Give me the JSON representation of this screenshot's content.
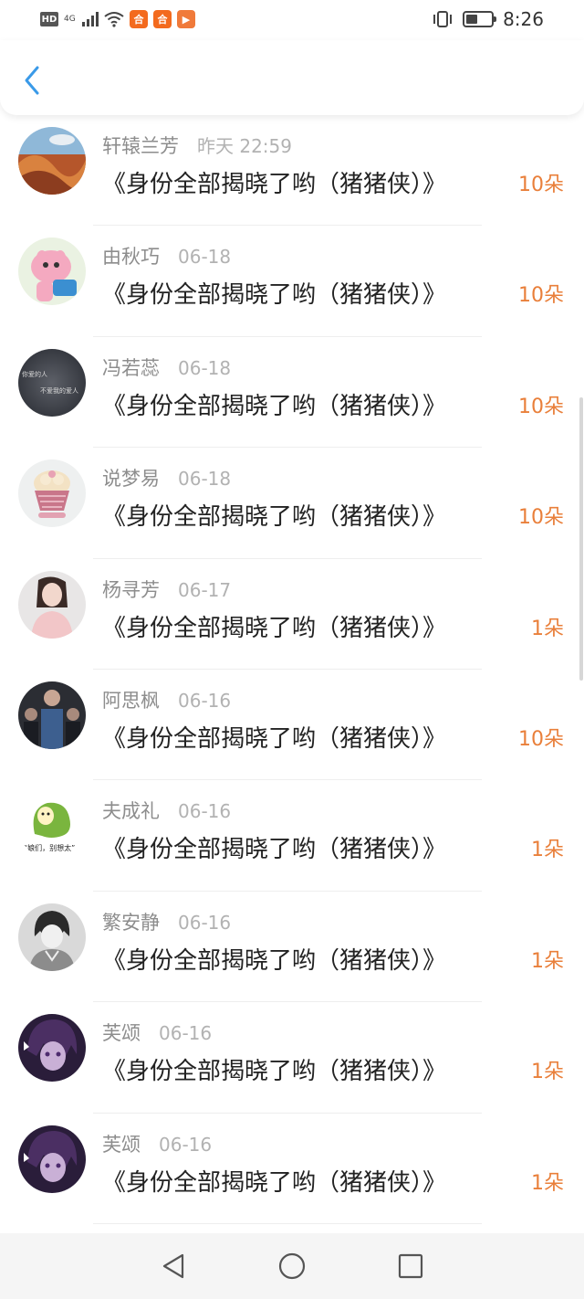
{
  "status_bar": {
    "hd": "HD",
    "network": "4G",
    "app_icon_1": "合",
    "app_icon_2": "合",
    "play_icon": "▶",
    "time": "8:26"
  },
  "header": {
    "back_icon": "chevron-left-icon",
    "accent_color": "#3a9ae8"
  },
  "list": {
    "amount_color": "#e97f3a",
    "items": [
      {
        "name": "轩辕兰芳",
        "time": "昨天 22:59",
        "title": "《身份全部揭晓了哟（猪猪侠）》",
        "amount": "10朵"
      },
      {
        "name": "由秋巧",
        "time": "06-18",
        "title": "《身份全部揭晓了哟（猪猪侠）》",
        "amount": "10朵"
      },
      {
        "name": "冯若蕊",
        "time": "06-18",
        "title": "《身份全部揭晓了哟（猪猪侠）》",
        "amount": "10朵"
      },
      {
        "name": "说梦易",
        "time": "06-18",
        "title": "《身份全部揭晓了哟（猪猪侠）》",
        "amount": "10朵"
      },
      {
        "name": "杨寻芳",
        "time": "06-17",
        "title": "《身份全部揭晓了哟（猪猪侠）》",
        "amount": "1朵"
      },
      {
        "name": "阿思枫",
        "time": "06-16",
        "title": "《身份全部揭晓了哟（猪猪侠）》",
        "amount": "10朵"
      },
      {
        "name": "夫成礼",
        "time": "06-16",
        "title": "《身份全部揭晓了哟（猪猪侠）》",
        "amount": "1朵"
      },
      {
        "name": "繁安静",
        "time": "06-16",
        "title": "《身份全部揭晓了哟（猪猪侠）》",
        "amount": "1朵"
      },
      {
        "name": "芙颂",
        "time": "06-16",
        "title": "《身份全部揭晓了哟（猪猪侠）》",
        "amount": "1朵"
      },
      {
        "name": "芙颂",
        "time": "06-16",
        "title": "《身份全部揭晓了哟（猪猪侠）》",
        "amount": "1朵"
      }
    ],
    "avatar_texts": {
      "item3_line1": "你爱的人",
      "item3_line2": "不爱我的爱人",
      "item7_caption": "“娘们，别想太”"
    }
  },
  "nav_bar": {
    "back_icon": "triangle-back-icon",
    "home_icon": "circle-home-icon",
    "recents_icon": "square-recents-icon"
  }
}
